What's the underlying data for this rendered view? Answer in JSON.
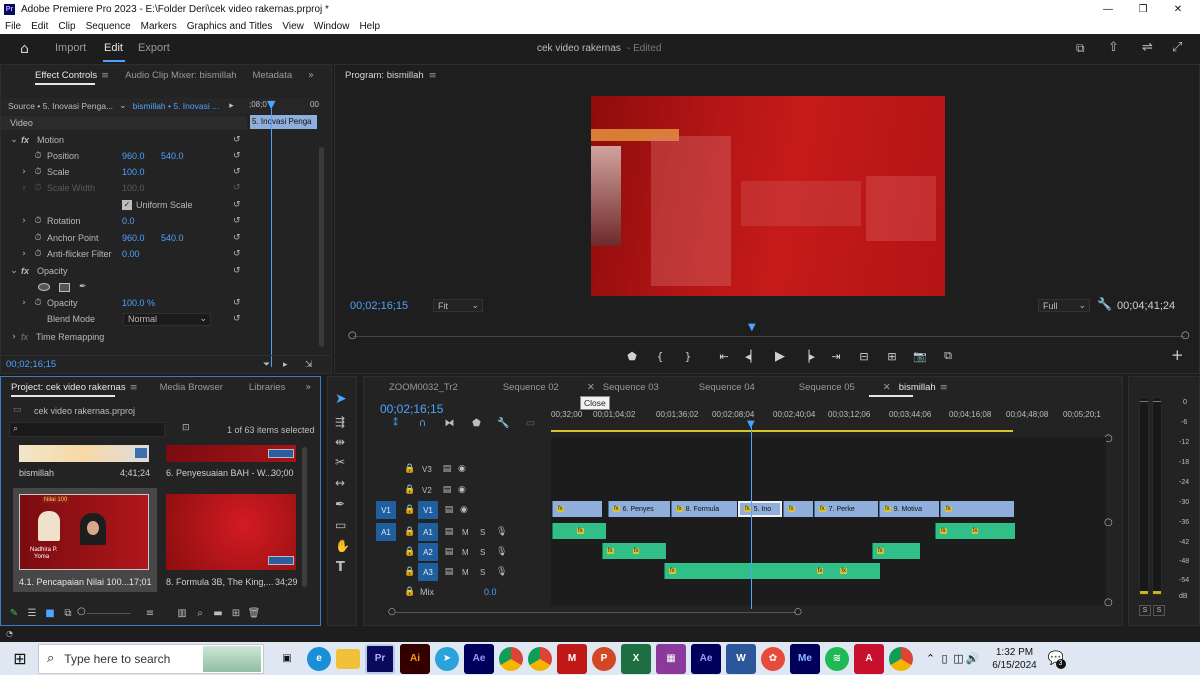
{
  "window": {
    "title": "Adobe Premiere Pro 2023 - E:\\Folder Deri\\cek video rakernas.prproj *",
    "minimize": "—",
    "maximize": "❐",
    "close": "✕"
  },
  "menu": [
    "File",
    "Edit",
    "Clip",
    "Sequence",
    "Markers",
    "Graphics and Titles",
    "View",
    "Window",
    "Help"
  ],
  "workspace": {
    "tabs": [
      "Import",
      "Edit",
      "Export"
    ],
    "active_tab": "Edit",
    "project_name": "cek video rakernas",
    "edited": "- Edited"
  },
  "effect_controls": {
    "tabs": [
      "Effect Controls",
      "Audio Clip Mixer: bismillah",
      "Metadata"
    ],
    "source": "Source • 5. Inovasi Penga...",
    "sequence": "bismillah • 5. Inovasi ...",
    "mini_timecode_start": ";08;0",
    "mini_timecode_end": "00",
    "mini_clip": "5. Inovasi Penga",
    "video_label": "Video",
    "motion_label": "Motion",
    "fx": "fx",
    "properties": [
      {
        "name": "Position",
        "v1": "960.0",
        "v2": "540.0"
      },
      {
        "name": "Scale",
        "v1": "100.0",
        "v2": ""
      },
      {
        "name": "Scale Width",
        "v1": "100.0",
        "v2": ""
      },
      {
        "name": "Rotation",
        "v1": "0.0",
        "v2": ""
      },
      {
        "name": "Anchor Point",
        "v1": "960.0",
        "v2": "540.0"
      },
      {
        "name": "Anti-flicker Filter",
        "v1": "0.00",
        "v2": ""
      }
    ],
    "uniform_scale": "Uniform Scale",
    "opacity_label": "Opacity",
    "opacity_prop": "Opacity",
    "opacity_value": "100.0 %",
    "blend_mode_label": "Blend Mode",
    "blend_mode_value": "Normal",
    "time_remapping": "Time Remapping",
    "timecode": "00;02;16;15"
  },
  "program": {
    "title": "Program: bismillah",
    "timecode": "00;02;16;15",
    "fit": "Fit",
    "quality": "Full",
    "duration": "00;04;41;24"
  },
  "project": {
    "tabs": [
      "Project: cek video rakernas",
      "Media Browser",
      "Libraries"
    ],
    "file": "cek video rakernas.prproj",
    "selected": "1 of 63 items selected",
    "items": [
      {
        "name": "bismillah",
        "duration": "4;41;24"
      },
      {
        "name": "6. Penyesuaian BAH - W...",
        "duration": "30;00"
      },
      {
        "name": "4.1. Pencapaian Nilai 100...",
        "duration": "17;01"
      },
      {
        "name": "8. Formula 3B, The King,...",
        "duration": "34;29"
      }
    ],
    "thumb_text": [
      "Nilai 100",
      "Nadhira P.",
      "Yoma"
    ]
  },
  "timeline": {
    "tabs": [
      "ZOOM0032_Tr2",
      "Sequence 02",
      "Sequence 03",
      "Sequence 04",
      "Sequence 05",
      "bismillah"
    ],
    "active_tab": "bismillah",
    "tooltip": "Close",
    "timecode": "00;02;16;15",
    "ruler": [
      "00;32;00",
      "00;01;04;02",
      "00;01;36;02",
      "00;02;08;04",
      "00;02;40;04",
      "00;03;12;06",
      "00;03;44;06",
      "00;04;16;08",
      "00;04;48;08",
      "00;05;20;1"
    ],
    "tracks": {
      "v3": "V3",
      "v2": "V2",
      "v1": "V1",
      "a1": "A1",
      "a2": "A2",
      "a3": "A3",
      "m": "M",
      "s": "S",
      "mix_label": "Mix",
      "mix_value": "0.0"
    },
    "video_clips": [
      "6. Penyes",
      "8. Formula",
      "5. Ino",
      "7. Perke",
      "9. Motiva"
    ],
    "fx": "fx"
  },
  "audio_meter": {
    "scale": [
      "0",
      "-6",
      "-12",
      "-18",
      "-24",
      "-30",
      "-36",
      "-42",
      "-48",
      "-54",
      "dB"
    ],
    "solo": [
      "S",
      "S"
    ]
  },
  "taskbar": {
    "search_placeholder": "Type here to search",
    "time": "1:32 PM",
    "date": "6/15/2024",
    "apps": [
      "Pr",
      "Ai",
      "Ae",
      "Ae",
      "Me"
    ],
    "notification_count": "3"
  }
}
